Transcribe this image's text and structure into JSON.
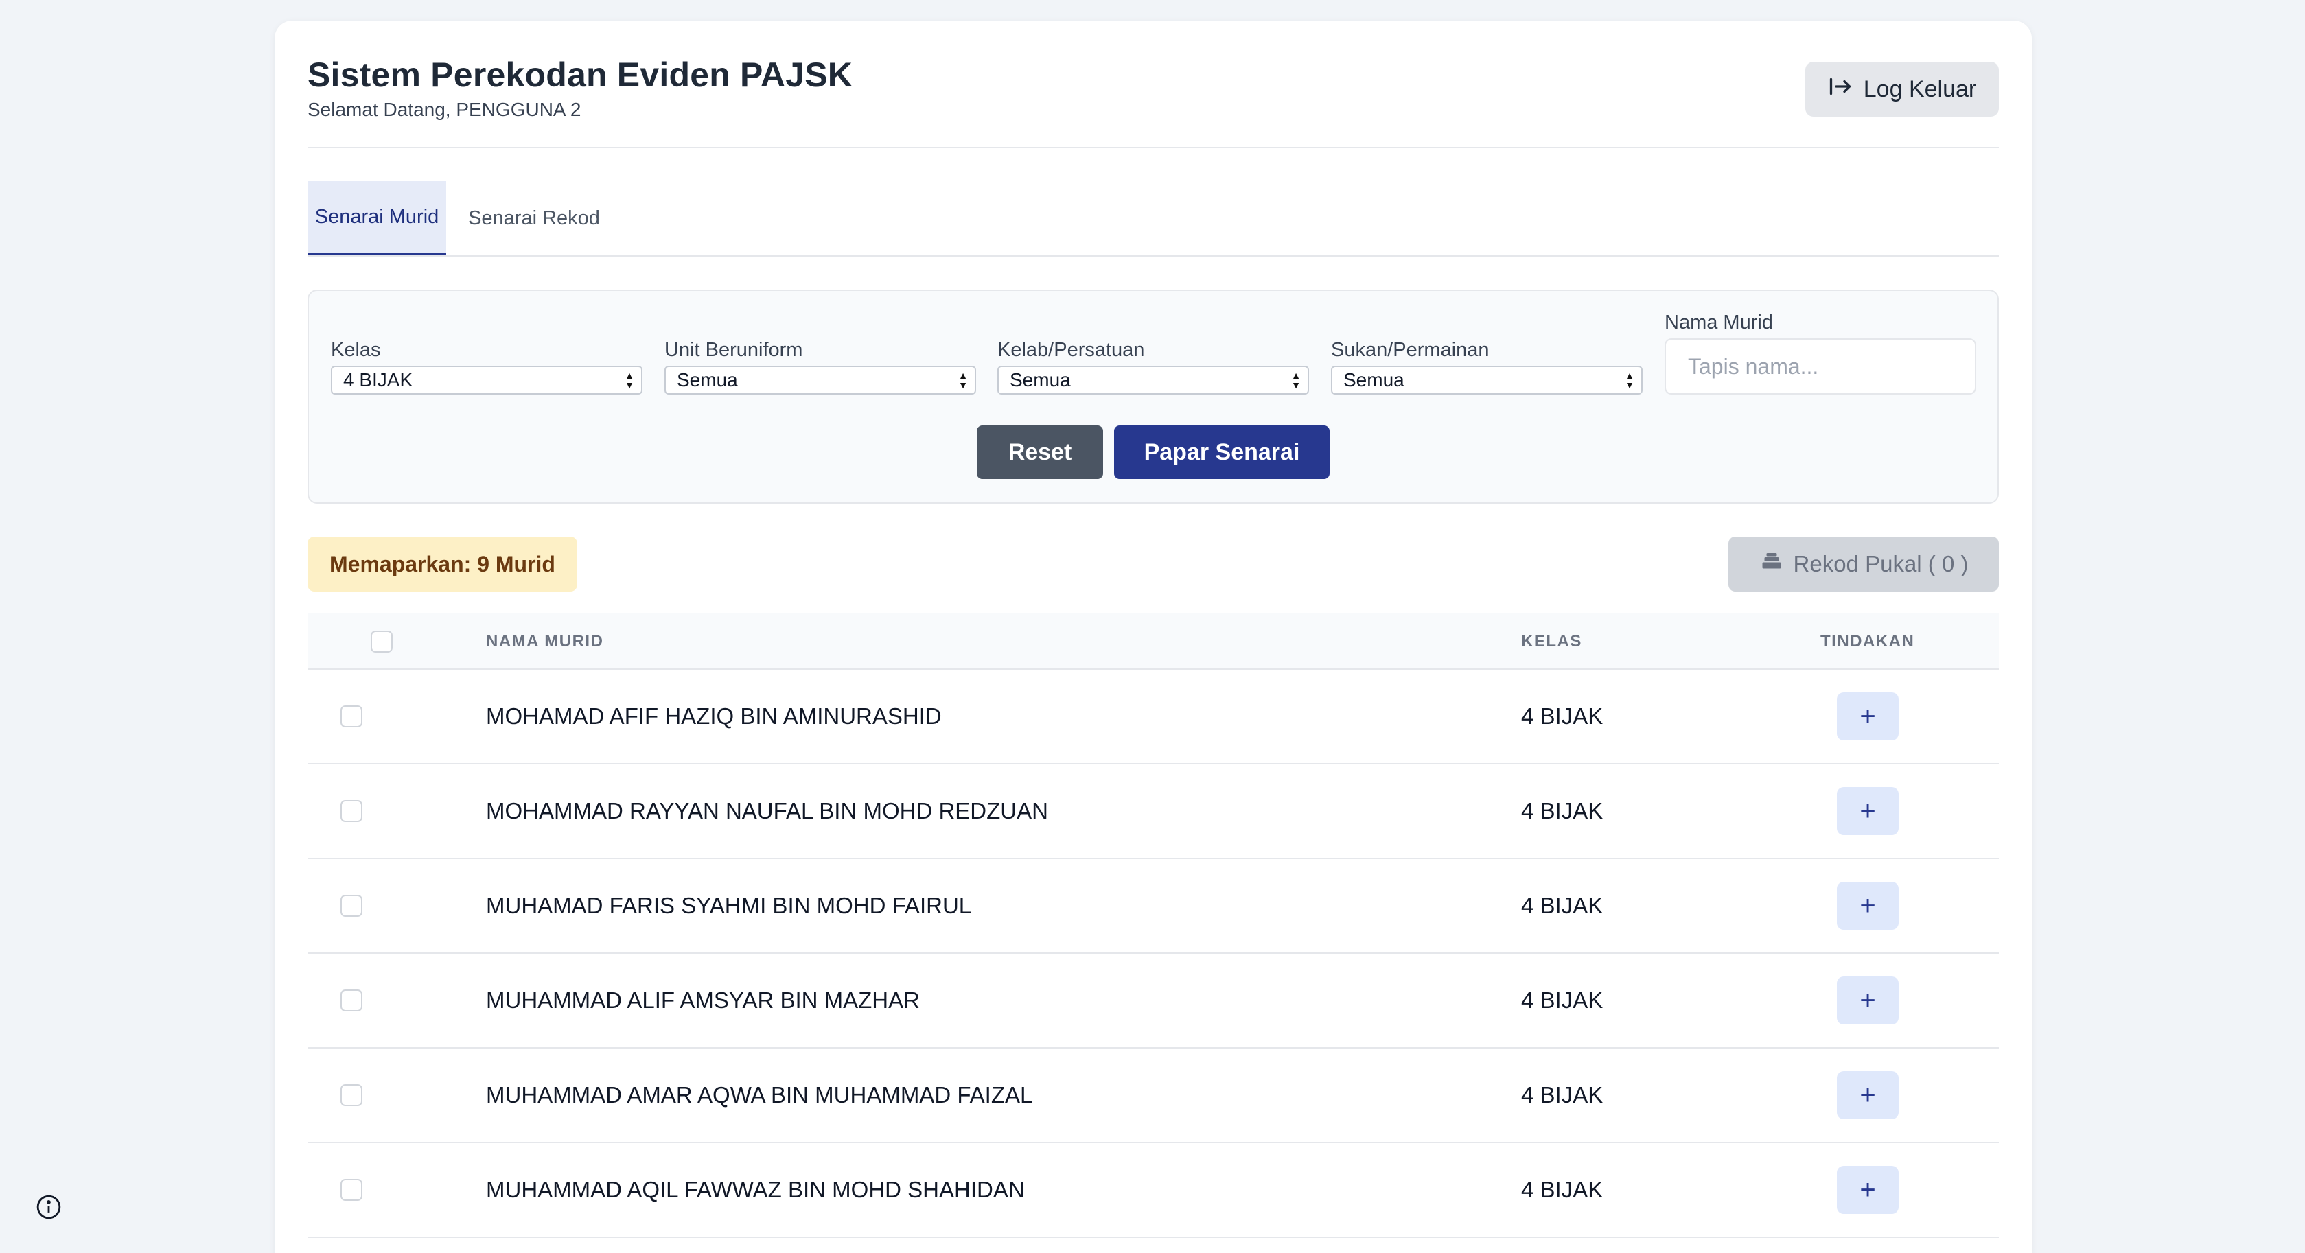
{
  "header": {
    "title": "Sistem Perekodan Eviden PAJSK",
    "subtitle": "Selamat Datang, PENGGUNA 2",
    "logout_label": "Log Keluar"
  },
  "tabs": [
    {
      "label": "Senarai Murid",
      "active": true
    },
    {
      "label": "Senarai Rekod",
      "active": false
    }
  ],
  "filters": {
    "kelas": {
      "label": "Kelas",
      "value": "4 BIJAK"
    },
    "unit": {
      "label": "Unit Beruniform",
      "value": "Semua"
    },
    "kelab": {
      "label": "Kelab/Persatuan",
      "value": "Semua"
    },
    "sukan": {
      "label": "Sukan/Permainan",
      "value": "Semua"
    },
    "nama": {
      "label": "Nama Murid",
      "placeholder": "Tapis nama..."
    },
    "reset_label": "Reset",
    "show_label": "Papar Senarai"
  },
  "summary": {
    "count_text": "Memaparkan: 9 Murid",
    "bulk_label": "Rekod Pukal (  0  )"
  },
  "table": {
    "headers": {
      "name": "NAMA MURID",
      "class": "KELAS",
      "action": "TINDAKAN"
    },
    "rows": [
      {
        "name": "MOHAMAD AFIF HAZIQ BIN AMINURASHID",
        "class": "4 BIJAK"
      },
      {
        "name": "MOHAMMAD RAYYAN NAUFAL BIN MOHD REDZUAN",
        "class": "4 BIJAK"
      },
      {
        "name": "MUHAMAD FARIS SYAHMI BIN MOHD FAIRUL",
        "class": "4 BIJAK"
      },
      {
        "name": "MUHAMMAD ALIF AMSYAR BIN MAZHAR",
        "class": "4 BIJAK"
      },
      {
        "name": "MUHAMMAD AMAR AQWA BIN MUHAMMAD FAIZAL",
        "class": "4 BIJAK"
      },
      {
        "name": "MUHAMMAD AQIL FAWWAZ BIN MOHD SHAHIDAN",
        "class": "4 BIJAK"
      }
    ],
    "action_symbol": "+"
  },
  "icons": {
    "logout": "logout-icon",
    "bulk": "stack-icon",
    "info": "info-icon"
  },
  "colors": {
    "primary": "#27388f",
    "reset": "#4b5563",
    "badge_bg": "#fdf0c6",
    "badge_text": "#6b3a10"
  }
}
